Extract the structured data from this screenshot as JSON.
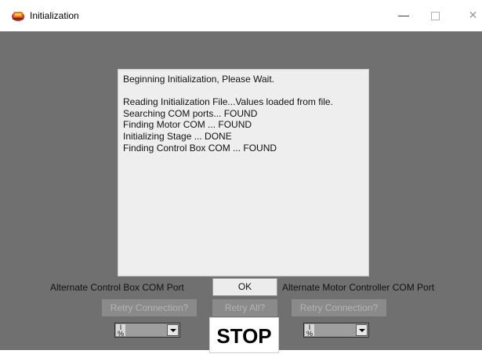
{
  "window": {
    "title": "Initialization",
    "minimize_glyph": "—",
    "close_glyph": "✕",
    "app_icon": "stage-motor-icon"
  },
  "log": {
    "text": "Beginning Initialization, Please Wait.\n\nReading Initialization File...Values loaded from file.\nSearching COM ports... FOUND\nFinding Motor COM ... FOUND\nInitializing Stage ... DONE\nFinding Control Box COM ... FOUND"
  },
  "labels": {
    "alt_control_box": "Alternate Control Box COM Port",
    "alt_motor_controller": "Alternate Motor Controller COM Port"
  },
  "buttons": {
    "ok": "OK",
    "retry_connection_left": "Retry Connection?",
    "retry_all": "Retry All?",
    "retry_connection_right": "Retry Connection?",
    "stop": "STOP"
  },
  "combos": {
    "io_glyph_top": "I",
    "io_glyph_bottom": "%",
    "left_value": "",
    "right_value": ""
  },
  "colors": {
    "panel_bg": "#707070",
    "disabled_button": "#8a8a8a"
  }
}
